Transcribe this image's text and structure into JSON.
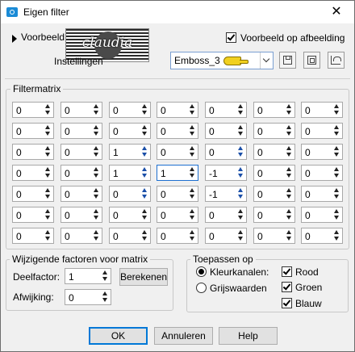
{
  "window": {
    "title": "Eigen filter",
    "close_glyph": "✕"
  },
  "preview": {
    "toggle_label": "Voorbeeld",
    "settings_label": "Instellingen",
    "logo_text": "claudia",
    "preview_on_image_label": "Voorbeeld op afbeelding",
    "preview_on_image_checked": true
  },
  "preset": {
    "selected": "Emboss_3"
  },
  "matrix": {
    "title": "Filtermatrix",
    "rows": [
      [
        "0",
        "0",
        "0",
        "0",
        "0",
        "0",
        "0"
      ],
      [
        "0",
        "0",
        "0",
        "0",
        "0",
        "0",
        "0"
      ],
      [
        "0",
        "0",
        "1",
        "0",
        "0",
        "0",
        "0"
      ],
      [
        "0",
        "0",
        "1",
        "1",
        "-1",
        "0",
        "0"
      ],
      [
        "0",
        "0",
        "0",
        "0",
        "-1",
        "0",
        "0"
      ],
      [
        "0",
        "0",
        "0",
        "0",
        "0",
        "0",
        "0"
      ],
      [
        "0",
        "0",
        "0",
        "0",
        "0",
        "0",
        "0"
      ]
    ]
  },
  "factors": {
    "title": "Wijzigende factoren voor matrix",
    "divisor_label": "Deelfactor:",
    "divisor_value": "1",
    "offset_label": "Afwijking:",
    "offset_value": "0",
    "calculate_label": "Berekenen"
  },
  "apply": {
    "title": "Toepassen op",
    "color_channels_label": "Kleurkanalen:",
    "grayscale_label": "Grijswaarden",
    "selected_mode": "color",
    "red_label": "Rood",
    "green_label": "Groen",
    "blue_label": "Blauw",
    "red_checked": true,
    "green_checked": true,
    "blue_checked": true
  },
  "footer": {
    "ok_label": "OK",
    "cancel_label": "Annuleren",
    "help_label": "Help"
  }
}
